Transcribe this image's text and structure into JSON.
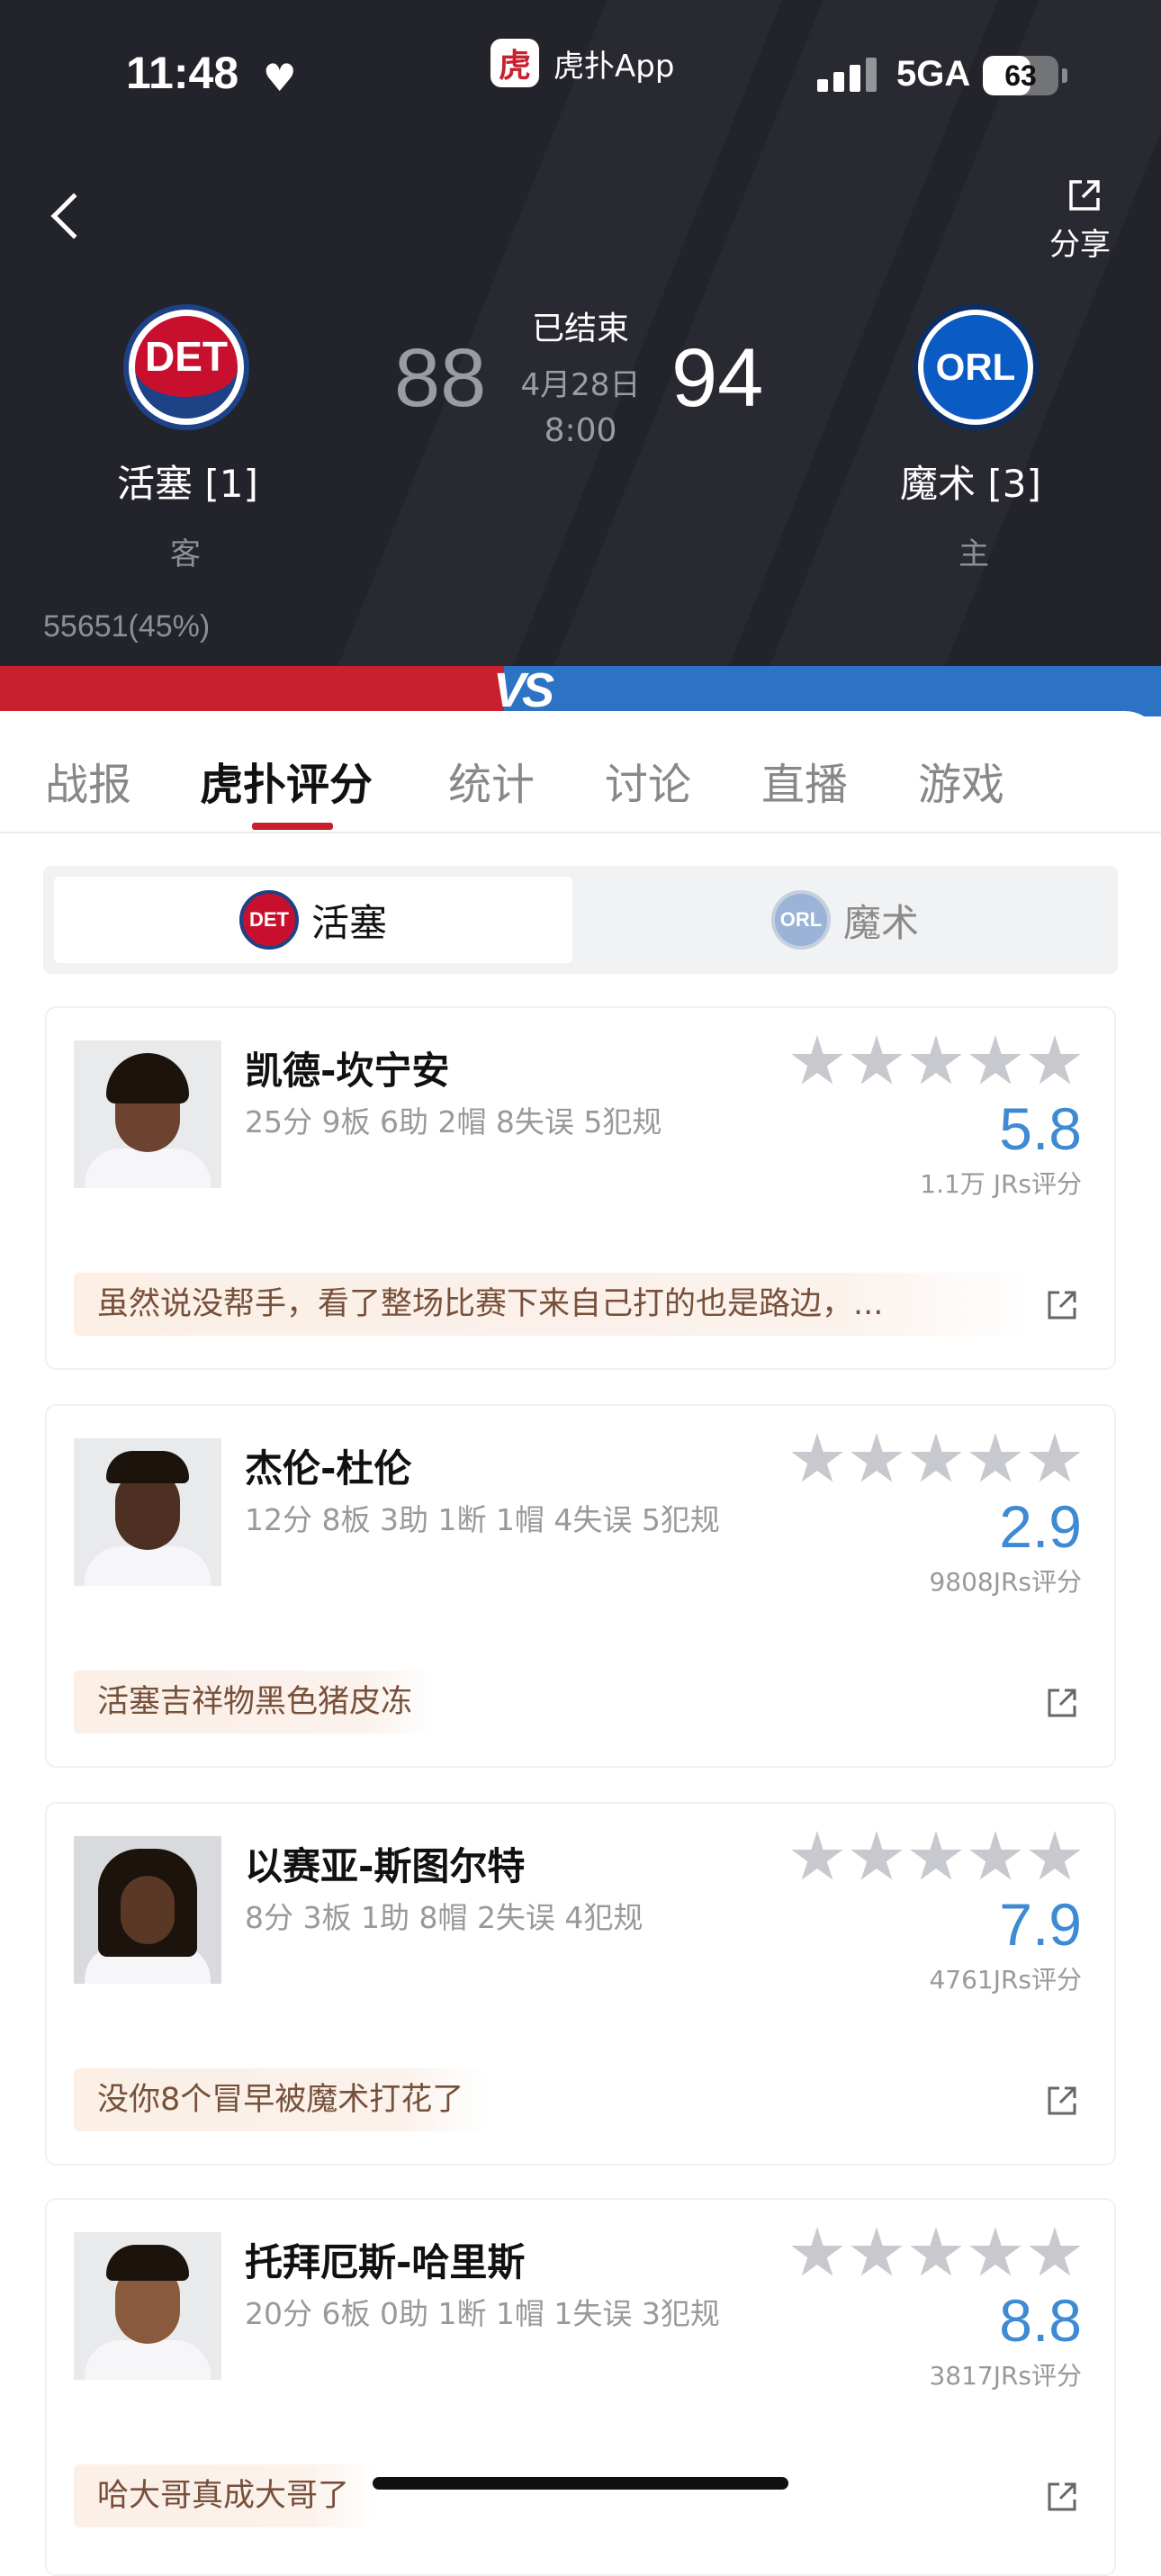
{
  "status_bar": {
    "time": "11:48",
    "heart": "♥",
    "app_badge_icon": "虎",
    "app_name": "虎扑App",
    "network": "5GA",
    "battery_level": "63",
    "battery_fraction": 0.63
  },
  "header": {
    "back_icon": "chevron-left-icon",
    "share_label": "分享",
    "status": "已结束",
    "date": "4月28日",
    "time": "8:00",
    "away": {
      "name": "活塞 [1]",
      "side": "客",
      "score": "88",
      "logo_text": "DET",
      "color": "#c8102e"
    },
    "home": {
      "name": "魔术 [3]",
      "side": "主",
      "score": "94",
      "logo_text": "ORL",
      "color": "#0b5bc4"
    },
    "support_text": "55651(45%)",
    "vs_text": "VS"
  },
  "tabs": [
    {
      "label": "战报",
      "active": false
    },
    {
      "label": "虎扑评分",
      "active": true
    },
    {
      "label": "统计",
      "active": false
    },
    {
      "label": "讨论",
      "active": false
    },
    {
      "label": "直播",
      "active": false
    },
    {
      "label": "游戏",
      "active": false
    }
  ],
  "team_toggle": {
    "det": {
      "label": "活塞",
      "logo_text": "DET",
      "selected": true
    },
    "orl": {
      "label": "魔术",
      "logo_text": "ORL",
      "selected": false
    }
  },
  "players": [
    {
      "name": "凯德-坎宁安",
      "stats": "25分 9板 6助 2帽 8失误 5犯规",
      "rating": "5.8",
      "votes": "1.1万 JRs评分",
      "comment": "虽然说没帮手，看了整场比赛下来自己打的也是路边，..."
    },
    {
      "name": "杰伦-杜伦",
      "stats": "12分 8板 3助 1断 1帽 4失误 5犯规",
      "rating": "2.9",
      "votes": "9808JRs评分",
      "comment": "活塞吉祥物黑色猪皮冻"
    },
    {
      "name": "以赛亚-斯图尔特",
      "stats": "8分 3板 1助 8帽 2失误 4犯规",
      "rating": "7.9",
      "votes": "4761JRs评分",
      "comment": "没你8个冒早被魔术打花了"
    },
    {
      "name": "托拜厄斯-哈里斯",
      "stats": "20分 6板 0助 1断 1帽 1失误 3犯规",
      "rating": "8.8",
      "votes": "3817JRs评分",
      "comment": "哈大哥真成大哥了"
    }
  ],
  "colors": {
    "header_bg": "#23242b",
    "accent_red": "#c8202f",
    "accent_blue": "#2d73c4",
    "rating_blue": "#3e8ad3",
    "star_gray": "#c8c9ce"
  }
}
